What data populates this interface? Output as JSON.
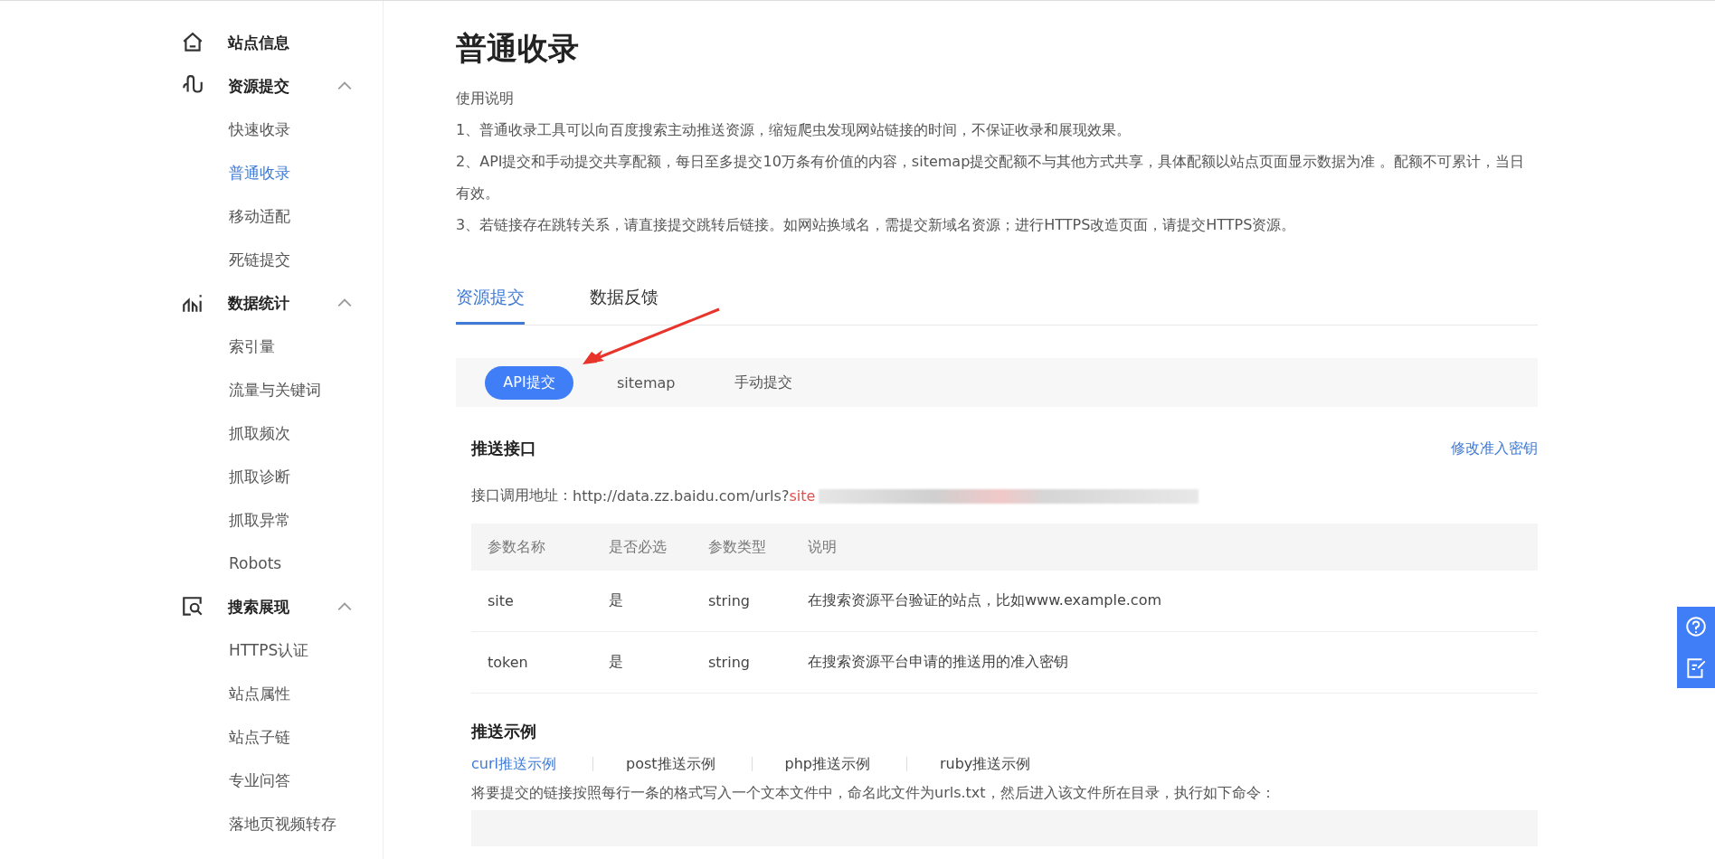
{
  "sidebar": {
    "items": [
      {
        "label": "站点信息",
        "kind": "home"
      },
      {
        "label": "资源提交",
        "kind": "submit",
        "expanded": true,
        "children": [
          {
            "label": "快速收录",
            "selected": false
          },
          {
            "label": "普通收录",
            "selected": true
          },
          {
            "label": "移动适配",
            "selected": false
          },
          {
            "label": "死链提交",
            "selected": false
          }
        ]
      },
      {
        "label": "数据统计",
        "kind": "stats",
        "expanded": true,
        "children": [
          {
            "label": "索引量",
            "selected": false
          },
          {
            "label": "流量与关键词",
            "selected": false
          },
          {
            "label": "抓取频次",
            "selected": false
          },
          {
            "label": "抓取诊断",
            "selected": false
          },
          {
            "label": "抓取异常",
            "selected": false
          },
          {
            "label": "Robots",
            "selected": false
          }
        ]
      },
      {
        "label": "搜索展现",
        "kind": "search",
        "expanded": true,
        "children": [
          {
            "label": "HTTPS认证",
            "selected": false
          },
          {
            "label": "站点属性",
            "selected": false
          },
          {
            "label": "站点子链",
            "selected": false
          },
          {
            "label": "专业问答",
            "selected": false
          },
          {
            "label": "落地页视频转存",
            "selected": false
          }
        ]
      }
    ]
  },
  "page": {
    "title": "普通收录",
    "intro_heading": "使用说明",
    "intro": [
      "1、普通收录工具可以向百度搜索主动推送资源，缩短爬虫发现网站链接的时间，不保证收录和展现效果。",
      "2、API提交和手动提交共享配额，每日至多提交10万条有价值的内容，sitemap提交配额不与其他方式共享，具体配额以站点页面显示数据为准 。配额不可累计，当日有效。",
      "3、若链接存在跳转关系，请直接提交跳转后链接。如网站换域名，需提交新域名资源；进行HTTPS改造页面，请提交HTTPS资源。"
    ]
  },
  "tabs": [
    {
      "label": "资源提交",
      "selected": true
    },
    {
      "label": "数据反馈",
      "selected": false
    }
  ],
  "subtabs": [
    {
      "label": "API提交",
      "selected": true
    },
    {
      "label": "sitemap",
      "selected": false
    },
    {
      "label": "手动提交",
      "selected": false
    }
  ],
  "push_api": {
    "title": "推送接口",
    "link": "修改准入密钥",
    "url_label": "接口调用地址：",
    "url": "http://data.zz.baidu.com/urls?",
    "url_param": "site"
  },
  "table": {
    "columns": [
      "参数名称",
      "是否必选",
      "参数类型",
      "说明"
    ],
    "rows": [
      [
        "site",
        "是",
        "string",
        "在搜索资源平台验证的站点，比如www.example.com"
      ],
      [
        "token",
        "是",
        "string",
        "在搜索资源平台申请的推送用的准入密钥"
      ]
    ]
  },
  "examples": {
    "title": "推送示例",
    "tabs": [
      {
        "label": "curl推送示例",
        "selected": true
      },
      {
        "label": "post推送示例",
        "selected": false
      },
      {
        "label": "php推送示例",
        "selected": false
      },
      {
        "label": "ruby推送示例",
        "selected": false
      }
    ],
    "instruction": "将要提交的链接按照每行一条的格式写入一个文本文件中，命名此文件为urls.txt，然后进入该文件所在目录，执行如下命令："
  }
}
